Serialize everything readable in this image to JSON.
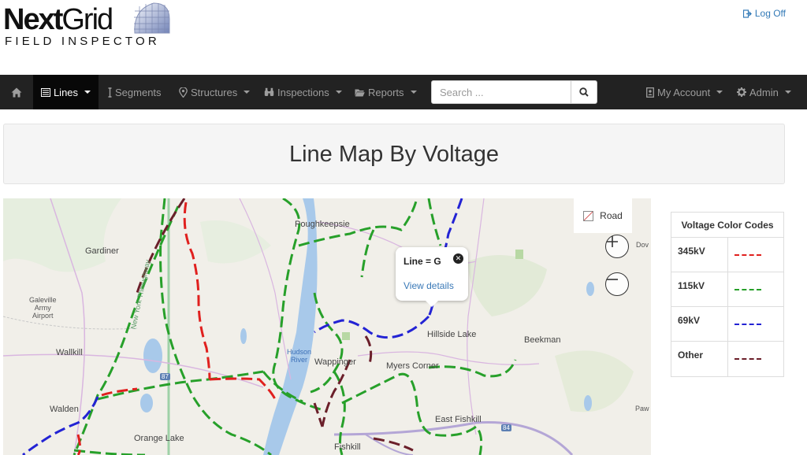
{
  "header": {
    "logo_brand_bold": "Next",
    "logo_brand_light": "Grid",
    "logo_subtitle": "FIELD INSPECTOR",
    "logout_label": "Log Off"
  },
  "navbar": {
    "items": [
      {
        "label": "Lines",
        "icon": "list-icon",
        "active": true
      },
      {
        "label": "Segments",
        "icon": "segment-icon"
      },
      {
        "label": "Structures",
        "icon": "map-pin-icon"
      },
      {
        "label": "Inspections",
        "icon": "binoculars-icon"
      },
      {
        "label": "Reports",
        "icon": "folder-icon"
      }
    ],
    "search_placeholder": "Search ...",
    "right_items": [
      {
        "label": "My Account",
        "icon": "id-card-icon"
      },
      {
        "label": "Admin",
        "icon": "gear-icon"
      }
    ]
  },
  "page_title": "Line Map By Voltage",
  "map": {
    "road_label": "Road",
    "places": {
      "poughkeepsie": "Poughkeepsie",
      "gardiner": "Gardiner",
      "galeville": "Galeville\nArmy\nAirport",
      "wallkill": "Wallkill",
      "walden": "Walden",
      "orange_lake": "Orange Lake",
      "hudson_river": "Hudson\nRiver",
      "wappinger": "Wappinger",
      "myers_corner": "Myers Corner",
      "hillside_lake": "Hillside Lake",
      "beekman": "Beekman",
      "east_fishkill": "East Fishkill",
      "fishkill": "Fishkill",
      "throughway": "New York Throughway",
      "dov": "Dov",
      "paw": "Paw",
      "route87": "87",
      "route84": "84"
    },
    "popup": {
      "title": "Line = G",
      "link": "View details"
    }
  },
  "legend": {
    "title": "Voltage Color Codes",
    "rows": [
      {
        "name": "345kV",
        "color": "#e0201e"
      },
      {
        "name": "115kV",
        "color": "#27a02a"
      },
      {
        "name": "69kV",
        "color": "#2323d4"
      },
      {
        "name": "Other",
        "color": "#6b1f2a"
      }
    ]
  },
  "colors": {
    "navbar_bg": "#222222",
    "link": "#337ab7",
    "line_345": "#e0201e",
    "line_115": "#27a02a",
    "line_69": "#2323d4",
    "line_other": "#6b1f2a"
  }
}
